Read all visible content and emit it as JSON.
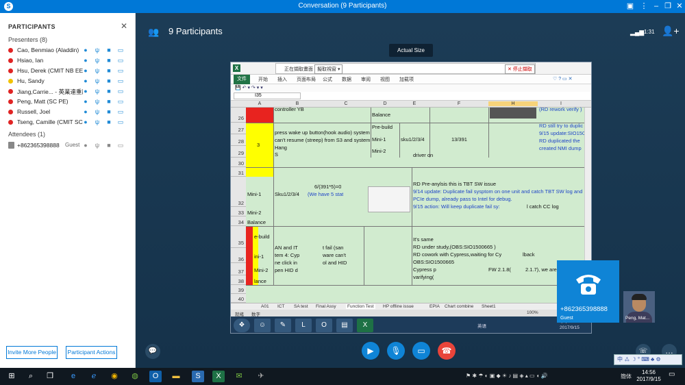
{
  "window": {
    "title": "Conversation (9 Participants)"
  },
  "left_panel": {
    "heading": "PARTICIPANTS",
    "presenters_label": "Presenters (8)",
    "presenters": [
      {
        "name": "Cao, Benmiao (Aladdin)",
        "status_color": "#e02424"
      },
      {
        "name": "Hsiao, Ian",
        "status_color": "#e02424"
      },
      {
        "name": "Hsu, Derek (CMIT NB EE)",
        "status_color": "#e02424"
      },
      {
        "name": "Hu, Sandy",
        "status_color": "#f2c200"
      },
      {
        "name": "Jiang,Carrie... - 英業達重慶",
        "status_color": "#e02424"
      },
      {
        "name": "Peng, Matt (SC PE)",
        "status_color": "#e02424"
      },
      {
        "name": "Russell, Joel",
        "status_color": "#e02424"
      },
      {
        "name": "Tseng, Camille (CMIT SC...",
        "status_color": "#e02424"
      }
    ],
    "attendees_label": "Attendees (1)",
    "attendees": [
      {
        "name": "+862365398888",
        "role": "Guest"
      }
    ],
    "invite_button": "Invite More People",
    "actions_button": "Participant Actions"
  },
  "header": {
    "participants_label": "9 Participants",
    "call_time": "1:31",
    "tooltip": "Actual Size"
  },
  "excel": {
    "toolbar_text": "正在擷取畫面",
    "toolbar_dropdown": "擬取視窗 ▾",
    "stop_share": "✕ 停止擷取",
    "ribbon_tabs": [
      "文件",
      "开始",
      "插入",
      "页面布局",
      "公式",
      "数据",
      "审阅",
      "视图",
      "加载项"
    ],
    "name_box": "I35",
    "columns": [
      "A",
      "B",
      "C",
      "D",
      "E",
      "F",
      "H",
      "I"
    ],
    "rows": [
      "26",
      "27",
      "28",
      "29",
      "30",
      "31",
      "32",
      "33",
      "34",
      "35",
      "36",
      "37",
      "38",
      "39",
      "40"
    ],
    "cells": {
      "b_controller": "controller  YB",
      "d_balance": "Balance",
      "i_rework": "(RD rework verify )",
      "d_prebuild": "Pre-build",
      "b_press1": "press wake up button(hook audio) system",
      "b_press2": "can't resume (streep) from S3 and system",
      "b_press3": "Hang",
      "b_press4": "S",
      "a_num": "3",
      "d_mini1": "Mini-1",
      "e_sku": "sku1/2/3/4",
      "f_ratio": "13/391",
      "d_mini2": "Mini-2",
      "f_driver": "driver on",
      "i_still": "RD still try to duplic",
      "i_update": "9/15 update:SIO150",
      "i_dup": "RD duplicated the",
      "i_created": "created NMI dump",
      "a_mini1_32": "Mini-1",
      "b_sku_32": "Sku1/2/3/4",
      "c_formula": "6/(391*5)=0",
      "c_have": "(We have 5 stat",
      "f_preanalysis": "RD Pre-anylsis this is TBT SW  issue",
      "f_914": "9/14 update: Duplicate fail sysptom on one unit and catch TBT SW log and",
      "f_pcie": "PCIe dump, already pass to Intel for debug.",
      "f_915": "9/15 action: Will keep duplicate fail sy:",
      "f_catch": "l catch CC log",
      "a_mini2_33": "Mini-2",
      "a_balance_34": "Balance",
      "a_prebuild_35": "e-build",
      "b_an": "AN and  IT",
      "b_item": "tem 4: Cyp",
      "b_click": "ne click in",
      "b_open": "pen HID d",
      "c_tfail": "t fail (san",
      "c_ware": "ware can't",
      "c_hid": "ol and HID",
      "a_mini1_36": "ini-1",
      "a_mini2_37": "Mini-2",
      "a_balance_38": "lance",
      "f_same": "It's same",
      "f_under": "RD under study,(OBS:SIO1500665 )",
      "f_cowork": "RD cowork with Cypress,waiting for Cy",
      "f_lback": "lback",
      "f_obs": "OBS:SIO1500665",
      "f_cypress": "Cypress p",
      "f_fw": "FW 2.1.8(",
      "f_217": "2.1.7), we are",
      "f_verify": "varifying("
    },
    "sheet_tabs": [
      "A01",
      "ICT",
      "SA test",
      "Final Assy",
      "Function Test",
      "HP offline issue",
      "EPIA",
      "Chart combine",
      "Sheet1"
    ],
    "active_sheet": "Function Test",
    "status_ready": "就绪",
    "status_num": "数字",
    "zoom": "100%",
    "inner_clock_time": "下午 02:36",
    "inner_clock_date": "2017/9/15",
    "inner_lang": "英语"
  },
  "tiles": {
    "guest_number": "+862365398888",
    "guest_label": "Guest",
    "peng_label": "Peng, Mat..."
  },
  "ime": {
    "text": "中 ⁂ ☽ ° ⌨ ♣ ⚙"
  },
  "taskbar": {
    "lang": "簡体",
    "time": "14:56",
    "date": "2017/9/15"
  },
  "colors": {
    "skype_blue": "#0078d7",
    "excel_green_fill": "#d1ebcf",
    "hang_up_red": "#e8443a"
  }
}
